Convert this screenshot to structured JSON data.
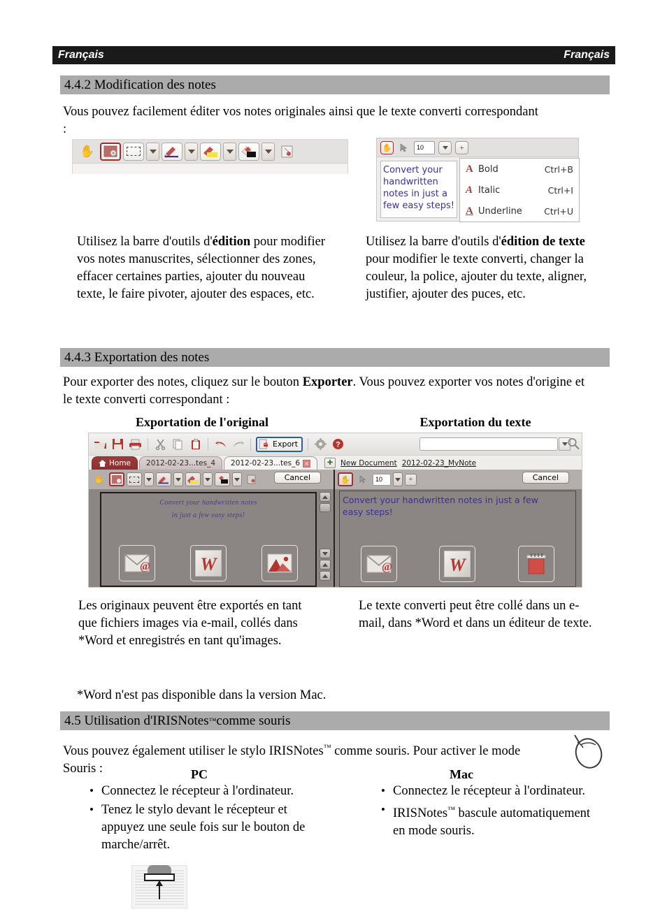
{
  "running_head": {
    "left": "Français",
    "right": "Français"
  },
  "sections": {
    "s442": {
      "heading": "4.4.2 Modification des notes",
      "intro": "Vous pouvez facilement éditer vos notes originales ainsi que le texte converti correspondant :",
      "left_caption_a": "Utilisez la barre d'outils d'",
      "left_caption_bold": "édition",
      "left_caption_b": " pour modifier vos notes manuscrites, sélectionner des zones, effacer certaines parties, ajouter du nouveau texte, le faire pivoter, ajouter des espaces, etc.",
      "right_caption_a": "Utilisez la barre d'outils d'",
      "right_caption_bold": "édition de texte",
      "right_caption_b": " pour modifier le texte converti, changer la couleur, la police, ajouter du texte, aligner, justifier, ajouter des puces, etc."
    },
    "s443": {
      "heading": "4.4.3 Exportation des notes",
      "intro_a": "Pour exporter des notes, cliquez sur le bouton ",
      "intro_bold": "Exporter",
      "intro_b": ". Vous pouvez exporter vos notes d'origine et le texte converti correspondant :",
      "col_left_header": "Exportation de l'original",
      "col_right_header": "Exportation du texte",
      "left_caption": "Les originaux peuvent être exportés en tant que fichiers images via e-mail, collés dans *Word et enregistrés en tant qu'images.",
      "right_caption": "Le texte converti peut être collé dans un e-mail, dans *Word et dans un éditeur de texte.",
      "footnote": "*Word n'est pas disponible dans la version Mac."
    },
    "s45": {
      "heading_a": "4.5 Utilisation d'IRISNotes",
      "heading_tm": "™",
      "heading_b": " comme souris",
      "intro_a": "Vous pouvez également utiliser le stylo IRISNotes",
      "intro_tm": "™",
      "intro_b": " comme souris. Pour activer le mode Souris :",
      "pc_header": "PC",
      "mac_header": "Mac",
      "pc_bullets": [
        "Connectez le récepteur à l'ordinateur.",
        "Tenez le stylo devant le récepteur et appuyez une seule fois sur le bouton de marche/arrêt."
      ],
      "mac_bullets_1": "Connectez le récepteur à l'ordinateur.",
      "mac_bullets_2_a": "IRISNotes",
      "mac_bullets_2_tm": "™",
      "mac_bullets_2_b": " bascule automatiquement en mode souris."
    }
  },
  "edit_toolbar": {
    "buttons": [
      "hand-tool",
      "settings-selected-tool",
      "rectangle-select-tool",
      "pen-tool",
      "highlighter-tool",
      "eraser-tool",
      "rotate-tool"
    ]
  },
  "text_toolbar": {
    "font_size": "10",
    "add_label": "+",
    "note_text": "Convert your handwritten notes in just a few easy steps!",
    "context_menu": [
      {
        "glyph": "A",
        "label": "Bold",
        "shortcut": "Ctrl+B"
      },
      {
        "glyph": "A",
        "label": "Italic",
        "shortcut": "Ctrl+I"
      },
      {
        "glyph": "A",
        "label": "Underline",
        "shortcut": "Ctrl+U"
      }
    ]
  },
  "appshot": {
    "toolbar": {
      "export_label": "Export",
      "icons": [
        "open-folder-icon",
        "save-icon",
        "print-icon",
        "cut-icon",
        "copy-icon",
        "paste-icon",
        "undo-icon",
        "redo-icon",
        "settings-icon",
        "help-icon"
      ],
      "search_value": "",
      "search_placeholder": ""
    },
    "tabs": [
      {
        "label": "Home",
        "state": "home"
      },
      {
        "label": "2012-02-23...tes_4",
        "state": "inactive"
      },
      {
        "label": "2012-02-23...tes_6",
        "state": "active",
        "close": "×"
      }
    ],
    "doc_links": [
      "New Document",
      "2012-02-23_MyNote"
    ],
    "left_pane": {
      "cancel_label": "Cancel",
      "ink_line1": "Convert your handwritten notes",
      "ink_line2": "in just a few easy steps!",
      "export_icons": [
        "email-export-icon",
        "word-export-icon",
        "image-export-icon"
      ]
    },
    "right_pane": {
      "cancel_label": "Cancel",
      "font_size": "10",
      "add_label": "+",
      "converted_text": "Convert your handwritten notes in just a few easy steps!",
      "export_icons": [
        "email-export-icon",
        "word-export-icon",
        "notepad-export-icon"
      ]
    }
  },
  "colors": {
    "header_bar": "#1a1a1a",
    "section_bar": "#ababab",
    "ink_blue": "#3a2f9c",
    "accent_red": "#a32a2a",
    "export_focus_blue": "#2a5db0"
  }
}
